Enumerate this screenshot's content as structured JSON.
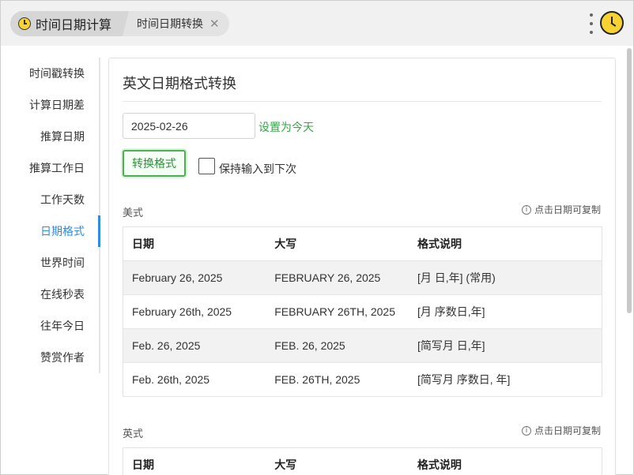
{
  "tabs": {
    "main_label": "时间日期计算",
    "sub_label": "时间日期转换",
    "close_glyph": "✕"
  },
  "sidebar": {
    "items": [
      {
        "label": "时间戳转换"
      },
      {
        "label": "计算日期差"
      },
      {
        "label": "推算日期"
      },
      {
        "label": "推算工作日"
      },
      {
        "label": "工作天数"
      },
      {
        "label": "日期格式"
      },
      {
        "label": "世界时间"
      },
      {
        "label": "在线秒表"
      },
      {
        "label": "往年今日"
      },
      {
        "label": "赞赏作者"
      }
    ],
    "active_label": "日期格式"
  },
  "card": {
    "title": "英文日期格式转换",
    "date_value": "2025-02-26",
    "set_today": "设置为今天",
    "convert_button": "转换格式",
    "keep_input_label": "保持输入到下次",
    "keep_input_checked": false,
    "copy_hint": "点击日期可复制",
    "info_glyph": "i"
  },
  "us_section": {
    "label": "美式",
    "headers": [
      "日期",
      "大写",
      "格式说明"
    ],
    "rows": [
      [
        "February 26, 2025",
        "FEBRUARY 26, 2025",
        "[月 日,年] (常用)"
      ],
      [
        "February 26th, 2025",
        "FEBRUARY 26TH, 2025",
        "[月 序数日,年]"
      ],
      [
        "Feb. 26, 2025",
        "FEB. 26, 2025",
        "[简写月 日,年]"
      ],
      [
        "Feb. 26th, 2025",
        "FEB. 26TH, 2025",
        "[简写月 序数日, 年]"
      ]
    ]
  },
  "uk_section": {
    "label": "英式",
    "headers": [
      "日期",
      "大写",
      "格式说明"
    ]
  },
  "colors": {
    "accent_blue": "#2e8ce8",
    "accent_green": "#3aa34a",
    "clock_yellow": "#f7d232"
  }
}
